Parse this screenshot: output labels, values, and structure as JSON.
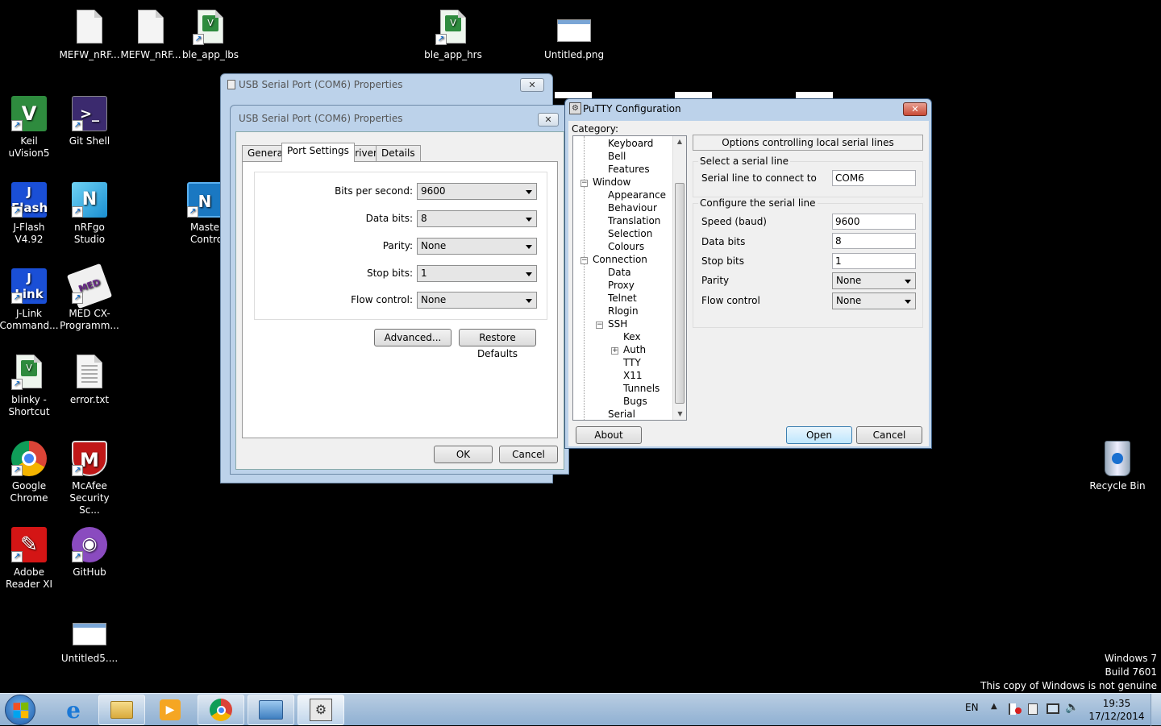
{
  "desktop": {
    "icons": [
      {
        "label": "MEFW_nRF..."
      },
      {
        "label": "MEFW_nRF..."
      },
      {
        "label": "ble_app_lbs"
      },
      {
        "label": "ble_app_hrs"
      },
      {
        "label": "Untitled.png"
      },
      {
        "label": "Keil uVision5"
      },
      {
        "label": "Git Shell"
      },
      {
        "label": "J-Flash V4.92"
      },
      {
        "label": "nRFgo Studio"
      },
      {
        "label": "Maste Contro"
      },
      {
        "label": "J-Link Command..."
      },
      {
        "label": "MED CX-Programm..."
      },
      {
        "label": "blinky - Shortcut"
      },
      {
        "label": "error.txt"
      },
      {
        "label": "Google Chrome"
      },
      {
        "label": "McAfee Security Sc..."
      },
      {
        "label": "Adobe Reader XI"
      },
      {
        "label": "GitHub"
      },
      {
        "label": "Untitled5...."
      },
      {
        "label": "Recycle Bin"
      }
    ],
    "watermark": {
      "line1": "Windows 7",
      "line2": "Build 7601",
      "line3": "This copy of Windows is not genuine"
    }
  },
  "usb_back": {
    "title": "USB Serial Port (COM6) Properties",
    "close": "✕"
  },
  "usb": {
    "title": "USB Serial Port (COM6) Properties",
    "close": "✕",
    "tabs": [
      "General",
      "Port Settings",
      "Driver",
      "Details"
    ],
    "fields": [
      {
        "label": "Bits per second:",
        "value": "9600"
      },
      {
        "label": "Data bits:",
        "value": "8"
      },
      {
        "label": "Parity:",
        "value": "None"
      },
      {
        "label": "Stop bits:",
        "value": "1"
      },
      {
        "label": "Flow control:",
        "value": "None"
      }
    ],
    "advanced": "Advanced...",
    "restore": "Restore Defaults",
    "ok": "OK",
    "cancel": "Cancel"
  },
  "putty": {
    "title": "PuTTY Configuration",
    "close": "✕",
    "category_label": "Category:",
    "tree": [
      "Keyboard",
      "Bell",
      "Features",
      "Window",
      "Appearance",
      "Behaviour",
      "Translation",
      "Selection",
      "Colours",
      "Connection",
      "Data",
      "Proxy",
      "Telnet",
      "Rlogin",
      "SSH",
      "Kex",
      "Auth",
      "TTY",
      "X11",
      "Tunnels",
      "Bugs",
      "Serial"
    ],
    "panel_header": "Options controlling local serial lines",
    "group1": "Select a serial line",
    "serial_line_label": "Serial line to connect to",
    "serial_line_value": "COM6",
    "group2": "Configure the serial line",
    "speed_label": "Speed (baud)",
    "speed_value": "9600",
    "databits_label": "Data bits",
    "databits_value": "8",
    "stopbits_label": "Stop bits",
    "stopbits_value": "1",
    "parity_label": "Parity",
    "parity_value": "None",
    "flow_label": "Flow control",
    "flow_value": "None",
    "about": "About",
    "open": "Open",
    "cancel": "Cancel"
  },
  "taskbar": {
    "lang": "EN",
    "time": "19:35",
    "date": "17/12/2014"
  }
}
